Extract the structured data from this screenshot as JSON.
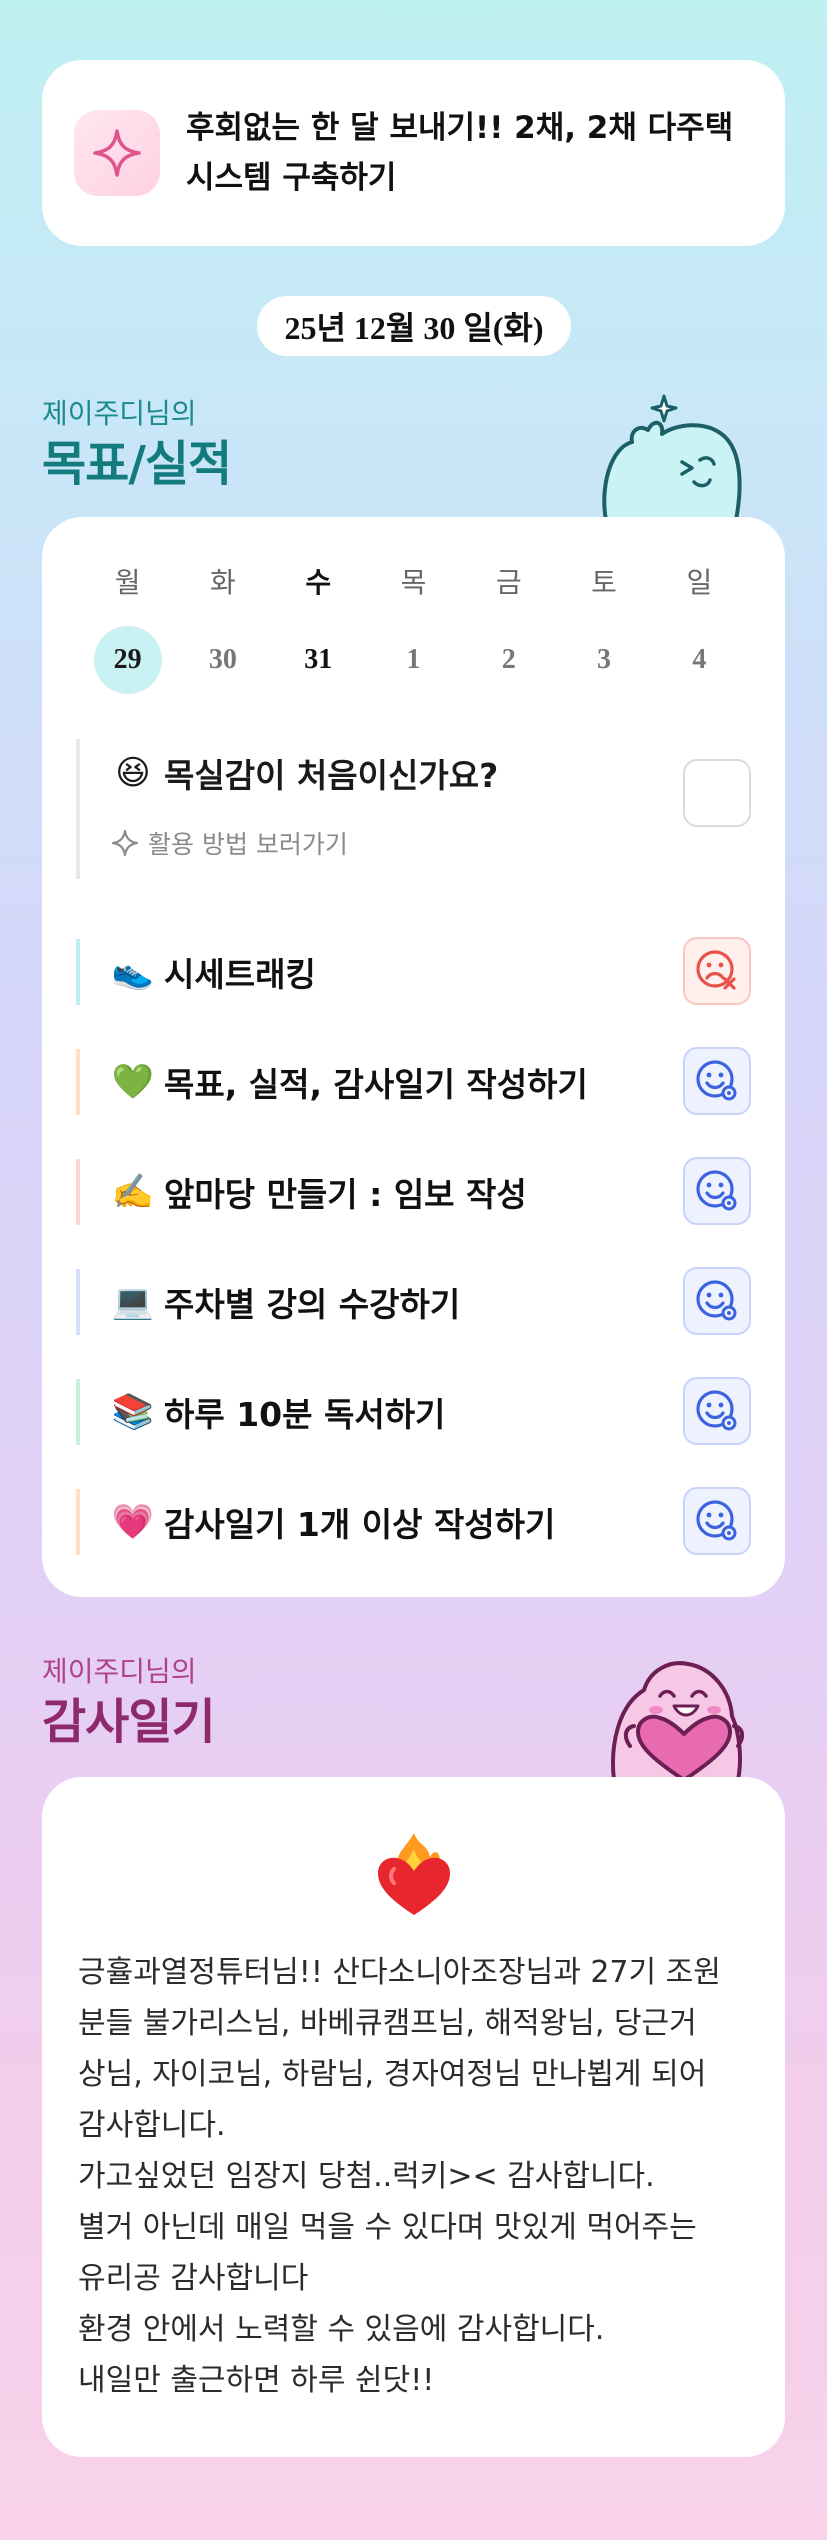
{
  "goal": {
    "text": "후회없는 한 달 보내기!! 2채, 2채 다주택 시스템 구축하기",
    "icon": "sparkle-icon"
  },
  "date_label": "25년 12월 30 일(화)",
  "goals_section": {
    "subtitle": "제이주디님의",
    "title": "목표/실적"
  },
  "calendar": {
    "weekdays": [
      "월",
      "화",
      "수",
      "목",
      "금",
      "토",
      "일"
    ],
    "dates": [
      "29",
      "30",
      "31",
      "1",
      "2",
      "3",
      "4"
    ],
    "selected_index": 0,
    "bold_index": 2
  },
  "onboarding": {
    "emoji": "😆",
    "title": "목실감이 처음이신가요?",
    "link": "활용 방법 보러가기"
  },
  "tasks": [
    {
      "emoji": "👟",
      "label": "시세트래킹",
      "status": "bad",
      "color": "#bdeef3"
    },
    {
      "emoji": "💚",
      "label": "목표, 실적, 감사일기 작성하기",
      "status": "good",
      "color": "#ffe0c7"
    },
    {
      "emoji": "✍️",
      "label": "앞마당 만들기 : 임보 작성",
      "status": "good",
      "color": "#ffd6d6"
    },
    {
      "emoji": "💻",
      "label": "주차별 강의 수강하기",
      "status": "good",
      "color": "#d6def9"
    },
    {
      "emoji": "📚",
      "label": "하루 10분 독서하기",
      "status": "good",
      "color": "#c9efd9"
    },
    {
      "emoji": "💗",
      "label": "감사일기 1개 이상 작성하기",
      "status": "good",
      "color": "#ffe0c7"
    }
  ],
  "thanks_section": {
    "subtitle": "제이주디님의",
    "title": "감사일기",
    "icon": "heart-on-fire-icon",
    "text": "긍휼과열정튜터님!! 산다소니아조장님과 27기 조원\n분들 불가리스님, 바베큐캠프님, 해적왕님, 당근거\n상님, 자이코님, 하람님, 경자여정님 만나뵙게 되어\n감사합니다.\n가고싶었던 임장지 당첨..럭키>< 감사합니다.\n별거 아닌데 매일 먹을 수 있다며 맛있게 먹어주는\n유리공 감사합니다\n환경 안에서 노력할 수 있음에 감사합니다.\n내일만 출근하면 하루 쉰닷!!"
  },
  "colors": {
    "teal_title": "#137a7e",
    "plum_title": "#8e2a6c",
    "good_face": "#3b63e0",
    "bad_face": "#e8524a"
  }
}
